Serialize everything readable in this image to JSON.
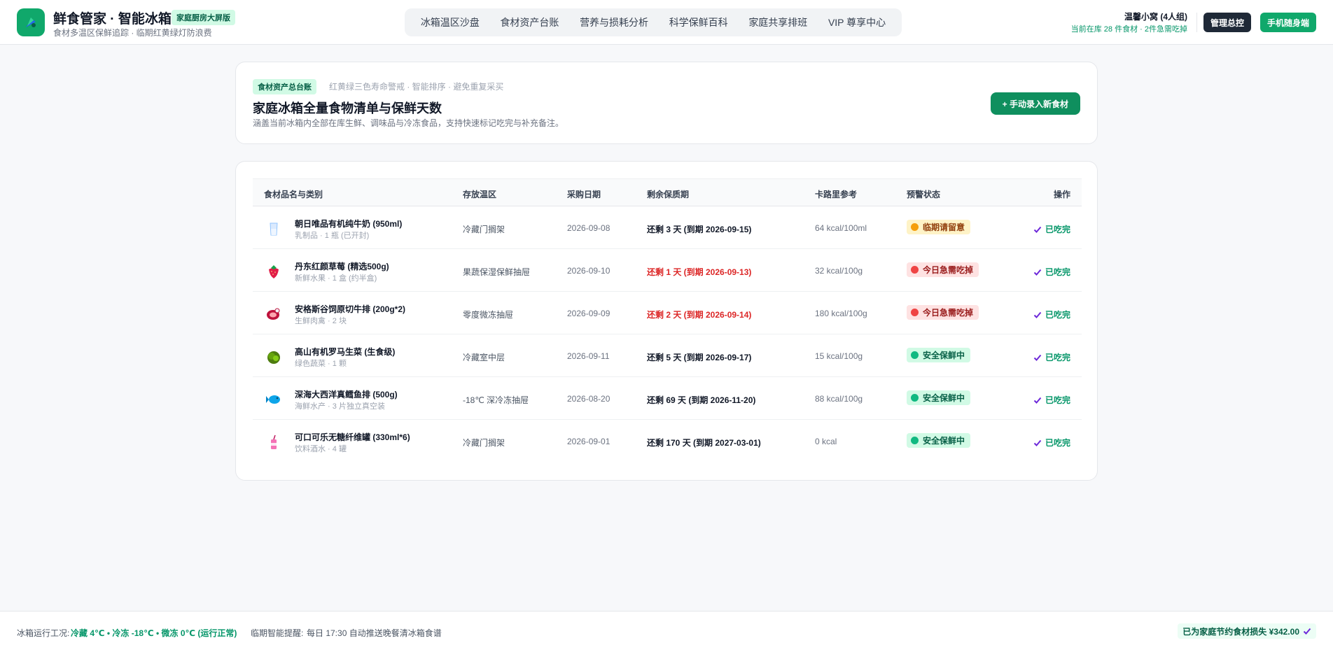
{
  "header": {
    "app_title": "鲜食管家 · 智能冰箱",
    "edition_badge": "家庭厨房大屏版",
    "subtitle": "食材多温区保鲜追踪 · 临期红黄绿灯防浪费",
    "nav": [
      "冰箱温区沙盘",
      "食材资产台账",
      "营养与损耗分析",
      "科学保鲜百科",
      "家庭共享排班",
      "VIP 尊享中心"
    ],
    "user_name": "温馨小窝 (4人组)",
    "stock_summary": "当前在库 28 件食材 · 2件急需吃掉",
    "admin_button": "管理总控",
    "mobile_button": "手机随身端"
  },
  "hero": {
    "tag": "食材资产总台账",
    "tagline": "红黄绿三色寿命警戒 · 智能排序 · 避免重复采买",
    "title": "家庭冰箱全量食物清单与保鲜天数",
    "description": "涵盖当前冰箱内全部在库生鲜、调味品与冷冻食品，支持快速标记吃完与补充备注。",
    "add_button": "+ 手动录入新食材"
  },
  "table": {
    "columns": [
      "食材品名与类别",
      "存放温区",
      "采购日期",
      "剩余保质期",
      "卡路里参考",
      "预警状态",
      "操作"
    ],
    "rows": [
      {
        "icon": "milk-icon",
        "name": "朝日唯品有机纯牛奶 (950ml)",
        "sub": "乳制品 · 1 瓶 (已开封)",
        "zone": "冷藏门搁架",
        "date": "2026-09-08",
        "remain": "还剩 3 天 (到期 2026-09-15)",
        "remain_color": "#111827",
        "kcal": "64 kcal/100ml",
        "status": "临期请留意",
        "status_level": "warning",
        "action": "已吃完"
      },
      {
        "icon": "strawberry-icon",
        "name": "丹东红颜草莓 (精选500g)",
        "sub": "新鲜水果 · 1 盒 (约半盒)",
        "zone": "果蔬保湿保鲜抽屉",
        "date": "2026-09-10",
        "remain": "还剩 1 天 (到期 2026-09-13)",
        "remain_color": "#dc2626",
        "kcal": "32 kcal/100g",
        "status": "今日急需吃掉",
        "status_level": "danger",
        "action": "已吃完"
      },
      {
        "icon": "steak-icon",
        "name": "安格斯谷饲原切牛排 (200g*2)",
        "sub": "生鲜肉禽 · 2 块",
        "zone": "零度微冻抽屉",
        "date": "2026-09-09",
        "remain": "还剩 2 天 (到期 2026-09-14)",
        "remain_color": "#dc2626",
        "kcal": "180 kcal/100g",
        "status": "今日急需吃掉",
        "status_level": "danger",
        "action": "已吃完"
      },
      {
        "icon": "lettuce-icon",
        "name": "高山有机罗马生菜 (生食级)",
        "sub": "绿色蔬菜 · 1 颗",
        "zone": "冷藏室中层",
        "date": "2026-09-11",
        "remain": "还剩 5 天 (到期 2026-09-17)",
        "remain_color": "#111827",
        "kcal": "15 kcal/100g",
        "status": "安全保鲜中",
        "status_level": "safe",
        "action": "已吃完"
      },
      {
        "icon": "fish-icon",
        "name": "深海大西洋真鳕鱼排 (500g)",
        "sub": "海鲜水产 · 3 片独立真空装",
        "zone": "-18℃ 深冷冻抽屉",
        "date": "2026-08-20",
        "remain": "还剩 69 天 (到期 2026-11-20)",
        "remain_color": "#111827",
        "kcal": "88 kcal/100g",
        "status": "安全保鲜中",
        "status_level": "safe",
        "action": "已吃完"
      },
      {
        "icon": "soda-icon",
        "name": "可口可乐无糖纤维罐 (330ml*6)",
        "sub": "饮料酒水 · 4 罐",
        "zone": "冷藏门搁架",
        "date": "2026-09-01",
        "remain": "还剩 170 天 (到期 2027-03-01)",
        "remain_color": "#111827",
        "kcal": "0 kcal",
        "status": "安全保鲜中",
        "status_level": "safe",
        "action": "已吃完"
      }
    ]
  },
  "status_styles": {
    "warning": {
      "bg": "#fef3c7",
      "fg": "#92400e",
      "dot": "#f59e0b"
    },
    "danger": {
      "bg": "#fee2e2",
      "fg": "#991b1b",
      "dot": "#ef4444"
    },
    "safe": {
      "bg": "#d1fae5",
      "fg": "#065f46",
      "dot": "#10b981"
    }
  },
  "footer": {
    "label_running": "冰箱运行工况:",
    "running_status": "冷藏 4℃ • 冷冻 -18℃ • 微冻 0℃ (运行正常)",
    "label_reminder": "临期智能提醒:",
    "reminder_text": "每日 17:30 自动推送晚餐清冰箱食谱",
    "saved_text": "已为家庭节约食材损失 ¥342.00"
  },
  "colors": {
    "brand_green": "#10a86b",
    "danger_red": "#dc2626",
    "dark_button": "#1f2937"
  }
}
